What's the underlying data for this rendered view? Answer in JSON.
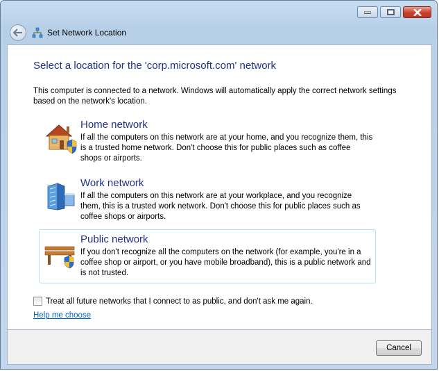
{
  "window": {
    "title": "Set Network Location",
    "minimize_icon": "minimize-icon",
    "maximize_icon": "maximize-icon",
    "close_icon": "close-icon"
  },
  "main": {
    "heading": "Select a location for the 'corp.microsoft.com' network",
    "intro": "This computer is connected to a network. Windows will automatically apply the correct network settings based on the network's location.",
    "options": [
      {
        "title": "Home network",
        "description": "If all the computers on this network are at your home, and you recognize them, this is a trusted home network.  Don't choose this for public places such as coffee shops or airports.",
        "icon": "home-network-icon"
      },
      {
        "title": "Work network",
        "description": "If all the computers on this network are at your workplace, and you recognize them, this is a trusted work network.  Don't choose this for public places such as coffee shops or airports.",
        "icon": "work-network-icon"
      },
      {
        "title": "Public network",
        "description": "If you don't recognize all the computers on the network (for example, you're in a coffee shop or airport, or you have mobile broadband), this is a public network and is not trusted.",
        "icon": "public-network-icon"
      }
    ],
    "checkbox_label": "Treat all future networks that I connect to as public, and don't ask me again.",
    "checkbox_checked": false,
    "help_link": "Help me choose"
  },
  "footer": {
    "cancel_label": "Cancel"
  }
}
